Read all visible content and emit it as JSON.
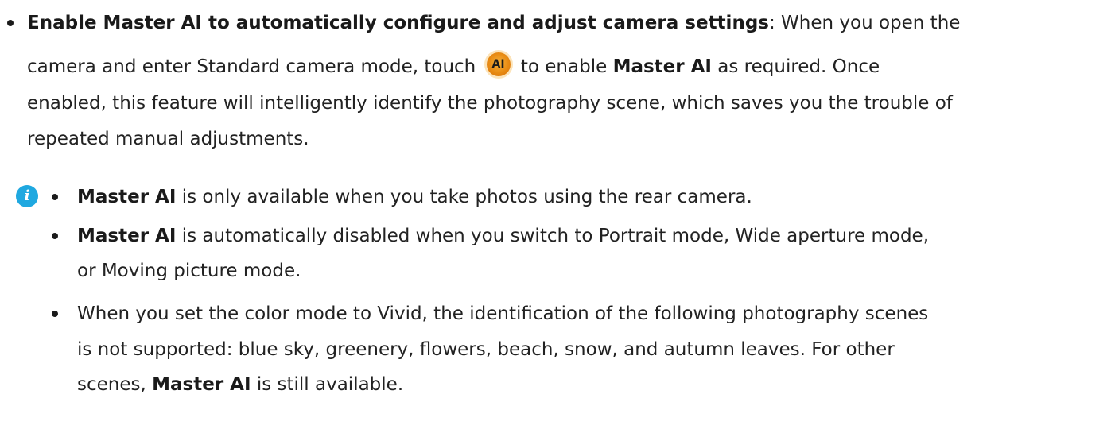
{
  "section": {
    "heading": "Enable Master AI to automatically configure and adjust camera settings",
    "heading_suffix": ": When you open the",
    "line2_pre": "camera and enter Standard camera mode, touch",
    "icon_label": "AI",
    "line2_mid": "to enable",
    "line2_bold": "Master AI",
    "line2_post": "as required. Once",
    "line3": "enabled, this feature will intelligently identify the photography scene, which saves you the trouble of",
    "line4": "repeated manual adjustments."
  },
  "note": {
    "icon": "info-icon",
    "items": [
      {
        "bold": "Master AI",
        "text": "is only available when you take photos using the rear camera."
      },
      {
        "bold": "Master AI",
        "text": "is automatically disabled when you switch to Portrait mode, Wide aperture mode,",
        "text2": "or Moving picture mode."
      },
      {
        "line1": "When you set the color mode to Vivid, the identification of the following photography scenes",
        "line2": "is not supported: blue sky, greenery, flowers, beach, snow, and autumn leaves. For other",
        "line3_pre": "scenes,",
        "bold": "Master AI",
        "line3_post": "is still available."
      }
    ]
  }
}
